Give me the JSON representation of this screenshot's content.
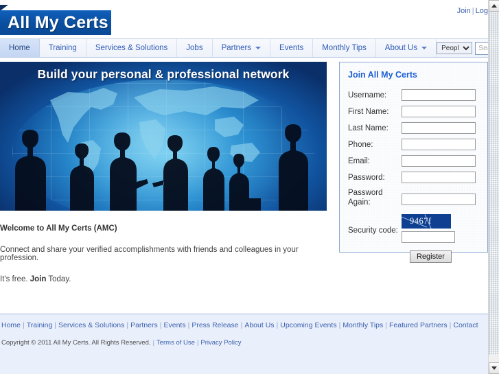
{
  "site": {
    "logo_text": "All My Certs"
  },
  "account": {
    "join_label": "Join",
    "separator": "|",
    "login_label": "Log"
  },
  "nav": {
    "items": [
      {
        "label": "Home",
        "active": true,
        "caret": false
      },
      {
        "label": "Training",
        "active": false,
        "caret": false
      },
      {
        "label": "Services & Solutions",
        "active": false,
        "caret": false
      },
      {
        "label": "Jobs",
        "active": false,
        "caret": false
      },
      {
        "label": "Partners",
        "active": false,
        "caret": true
      },
      {
        "label": "Events",
        "active": false,
        "caret": false
      },
      {
        "label": "Monthly Tips",
        "active": false,
        "caret": false
      },
      {
        "label": "About Us",
        "active": false,
        "caret": true
      }
    ]
  },
  "search": {
    "scope_selected": "People",
    "scope_options": [
      "People"
    ],
    "placeholder": "Search",
    "value": "",
    "button_icon": "search-icon"
  },
  "hero": {
    "title": "Build your personal & professional network"
  },
  "welcome": {
    "title": "Welcome to All My Certs (AMC)",
    "body": "Connect and share your verified accomplishments with friends and colleagues in your profession.",
    "free_prefix": "It's free. ",
    "join_link": "Join",
    "free_suffix": " Today."
  },
  "join_panel": {
    "heading": "Join All My Certs",
    "fields": [
      {
        "label": "Username:",
        "value": "",
        "name": "username"
      },
      {
        "label": "First Name:",
        "value": "",
        "name": "first-name"
      },
      {
        "label": "Last Name:",
        "value": "",
        "name": "last-name"
      },
      {
        "label": "Phone:",
        "value": "",
        "name": "phone"
      },
      {
        "label": "Email:",
        "value": "",
        "name": "email"
      },
      {
        "label": "Password:",
        "value": "",
        "name": "password"
      }
    ],
    "password_again_label_line1": "Password",
    "password_again_label_line2": "Again:",
    "security_label": "Security code:",
    "captcha_text": "9467f",
    "security_value": "",
    "register_label": "Register"
  },
  "footer": {
    "links": [
      "Home",
      "Training",
      "Services & Solutions",
      "Partners",
      "Events",
      "Press Release",
      "About Us",
      "Upcoming Events",
      "Monthly Tips",
      "Featured Partners",
      "Contact"
    ],
    "separator": "|",
    "copyright": "Copyright © 2011 All My Certs. All Rights Reserved.",
    "terms_label": "Terms of Use",
    "privacy_label": "Privacy Policy"
  },
  "colors": {
    "brand_blue": "#0b51a8",
    "link_blue": "#3a5fae",
    "nav_active": "#ccdcf5",
    "heading_blue": "#1f5fd6",
    "footer_bg": "#eaf0fb",
    "captcha_bg": "#0e3f91"
  }
}
